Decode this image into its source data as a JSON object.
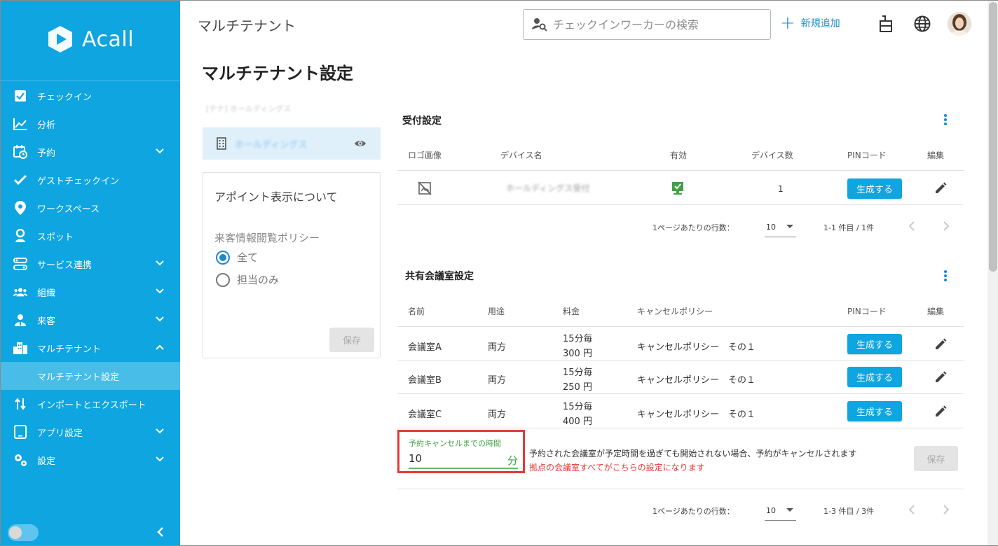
{
  "brand": {
    "name": "Acall"
  },
  "sidebar": {
    "items": [
      {
        "label": "チェックイン",
        "icon": "check-square-icon",
        "expand": false
      },
      {
        "label": "分析",
        "icon": "line-chart-icon",
        "expand": false
      },
      {
        "label": "予約",
        "icon": "calendar-clock-icon",
        "expand": true
      },
      {
        "label": "ゲストチェックイン",
        "icon": "checkmark-icon",
        "expand": false
      },
      {
        "label": "ワークスペース",
        "icon": "location-pin-icon",
        "expand": false
      },
      {
        "label": "スポット",
        "icon": "person-pin-icon",
        "expand": false
      },
      {
        "label": "サービス連携",
        "icon": "integration-icon",
        "expand": true
      },
      {
        "label": "組織",
        "icon": "group-icon",
        "expand": true
      },
      {
        "label": "来客",
        "icon": "visitor-icon",
        "expand": true
      },
      {
        "label": "マルチテナント",
        "icon": "building-icon",
        "expand": true
      },
      {
        "label": "インポートとエクスポート",
        "icon": "import-export-icon",
        "expand": false
      },
      {
        "label": "アプリ設定",
        "icon": "tablet-icon",
        "expand": true
      },
      {
        "label": "設定",
        "icon": "gears-icon",
        "expand": true
      }
    ],
    "subitem": "マルチテナント設定"
  },
  "header": {
    "title": "マルチテナント",
    "search_placeholder": "チェックインワーカーの検索",
    "add_new": "新規追加"
  },
  "page": {
    "title": "マルチテナント設定"
  },
  "left_panel": {
    "tenant_label": "[テナ] ホールディングス",
    "tenant_name": "ホールディングス",
    "appointment_title": "アポイント表示について",
    "policy_label": "来客情報閲覧ポリシー",
    "options": [
      "全て",
      "担当のみ"
    ],
    "selected_option": "全て",
    "save": "保存"
  },
  "reception": {
    "title": "受付設定",
    "headers": [
      "ロゴ画像",
      "デバイス名",
      "有効",
      "デバイス数",
      "PINコード",
      "編集"
    ],
    "row": {
      "device_name": "ホールディングス受付",
      "device_count": "1",
      "pin_button": "生成する"
    },
    "pager": {
      "rows_label": "1ページあたりの行数：",
      "rows_value": "10",
      "range": "1-1 件目 / 1件"
    }
  },
  "rooms": {
    "title": "共有会議室設定",
    "headers": [
      "名前",
      "用途",
      "料金",
      "キャンセルポリシー",
      "PINコード",
      "編集"
    ],
    "rows": [
      {
        "name": "会議室A",
        "use": "両方",
        "fee1": "15分毎",
        "fee2": "300 円",
        "policy": "キャンセルポリシー　その１",
        "pin": "生成する"
      },
      {
        "name": "会議室B",
        "use": "両方",
        "fee1": "15分毎",
        "fee2": "250 円",
        "policy": "キャンセルポリシー　その１",
        "pin": "生成する"
      },
      {
        "name": "会議室C",
        "use": "両方",
        "fee1": "15分毎",
        "fee2": "400 円",
        "policy": "キャンセルポリシー　その１",
        "pin": "生成する"
      }
    ],
    "cancel": {
      "label": "予約キャンセルまでの時間",
      "value": "10",
      "unit": "分",
      "note": "予約された会議室が予定時間を過ぎても開始されない場合、予約がキャンセルされます",
      "warning": "拠点の会議室すべてがこちらの設定になります",
      "save": "保存"
    },
    "pager": {
      "rows_label": "1ページあたりの行数：",
      "rows_value": "10",
      "range": "1-3 件目 / 3件"
    }
  }
}
